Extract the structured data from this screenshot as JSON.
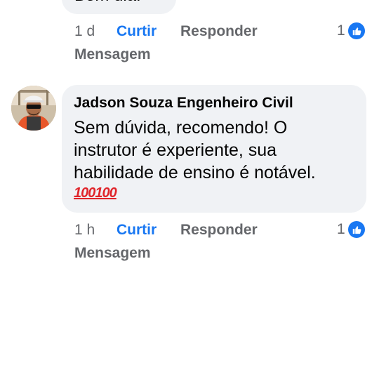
{
  "top_comment": {
    "partial_text": "Bom dia.",
    "time": "1 d",
    "like_label": "Curtir",
    "reply_label": "Responder",
    "reaction_count": "1",
    "message_label": "Mensagem"
  },
  "comment": {
    "author": "Jadson Souza Engenheiro Civil",
    "lines": [
      "Sem dúvida, recomendo! O",
      "instrutor é experiente, sua",
      "habilidade de ensino é notável."
    ],
    "emoji": [
      "100",
      "100"
    ],
    "time": "1 h",
    "like_label": "Curtir",
    "reply_label": "Responder",
    "reaction_count": "1",
    "message_label": "Mensagem"
  },
  "colors": {
    "bubble": "#f0f2f5",
    "meta": "#65676b",
    "like_blue": "#1877f2"
  },
  "icons": {
    "reaction": "thumbs-up-icon",
    "emoji": "hundred-points-icon"
  }
}
